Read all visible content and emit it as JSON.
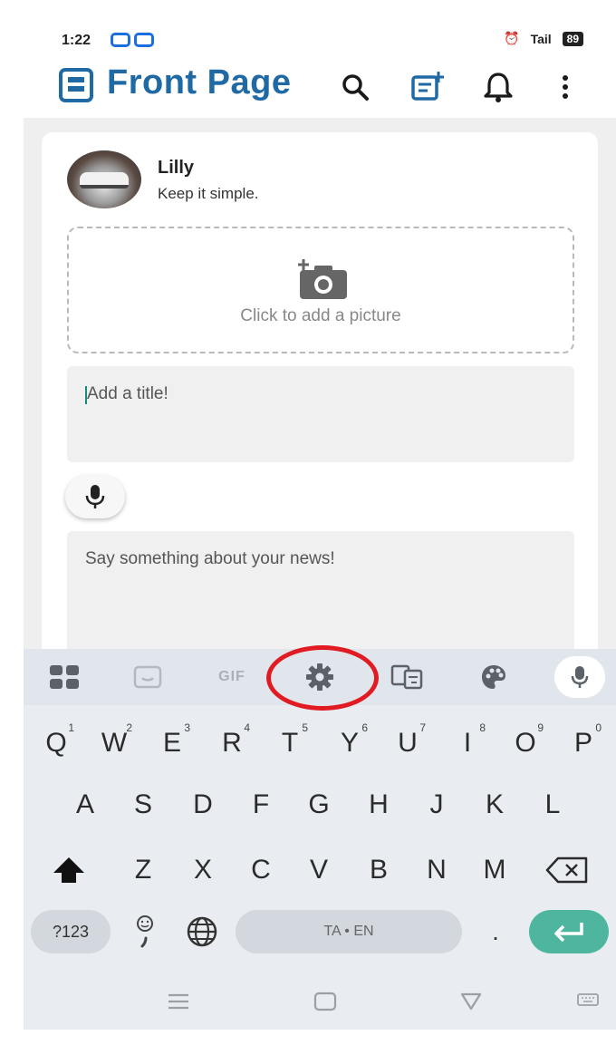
{
  "status_bar": {
    "time": "1:22",
    "network_label": "Tail",
    "battery": "89"
  },
  "app": {
    "title": "Front Page",
    "brand_color": "#1f6aa5"
  },
  "post_composer": {
    "user_name": "Lilly",
    "user_status": "Keep it simple.",
    "add_picture_label": "Click to add a picture",
    "title_placeholder": "Add a title!",
    "body_placeholder": "Say something about your news!"
  },
  "keyboard": {
    "toolbar": {
      "gif_label": "GIF",
      "items": [
        "apps-grid-icon",
        "sticker-icon",
        "gif",
        "settings-gear-icon",
        "translate-icon",
        "theme-palette-icon",
        "mic-icon"
      ],
      "highlighted": "settings-gear-icon",
      "highlight_color": "#e11b22"
    },
    "row1": [
      {
        "key": "Q",
        "hint": "1"
      },
      {
        "key": "W",
        "hint": "2"
      },
      {
        "key": "E",
        "hint": "3"
      },
      {
        "key": "R",
        "hint": "4"
      },
      {
        "key": "T",
        "hint": "5"
      },
      {
        "key": "Y",
        "hint": "6"
      },
      {
        "key": "U",
        "hint": "7"
      },
      {
        "key": "I",
        "hint": "8"
      },
      {
        "key": "O",
        "hint": "9"
      },
      {
        "key": "P",
        "hint": "0"
      }
    ],
    "row2": [
      "A",
      "S",
      "D",
      "F",
      "G",
      "H",
      "J",
      "K",
      "L"
    ],
    "row3": [
      "Z",
      "X",
      "C",
      "V",
      "B",
      "N",
      "M"
    ],
    "symbols_key": "?123",
    "space_label": "TA • EN",
    "period_key": ".",
    "accent_color": "#4eb59e"
  }
}
